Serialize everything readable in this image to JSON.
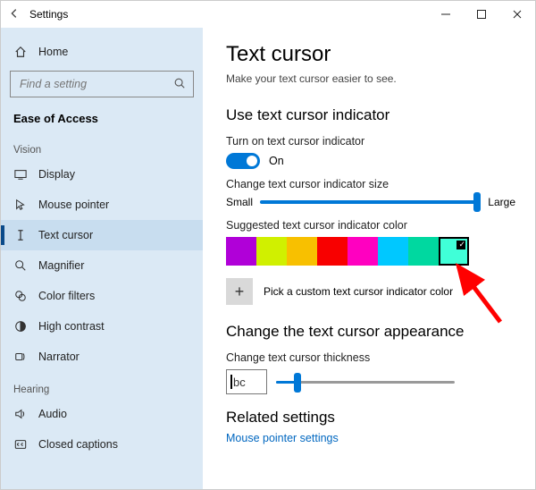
{
  "titlebar": {
    "app_title": "Settings"
  },
  "sidebar": {
    "home_label": "Home",
    "search_placeholder": "Find a setting",
    "section": "Ease of Access",
    "group_vision": "Vision",
    "group_hearing": "Hearing",
    "items_vision": [
      {
        "label": "Display"
      },
      {
        "label": "Mouse pointer"
      },
      {
        "label": "Text cursor"
      },
      {
        "label": "Magnifier"
      },
      {
        "label": "Color filters"
      },
      {
        "label": "High contrast"
      },
      {
        "label": "Narrator"
      }
    ],
    "items_hearing": [
      {
        "label": "Audio"
      },
      {
        "label": "Closed captions"
      }
    ]
  },
  "main": {
    "title": "Text cursor",
    "subtitle": "Make your text cursor easier to see.",
    "section_indicator": "Use text cursor indicator",
    "toggle_label": "Turn on text cursor indicator",
    "toggle_state": "On",
    "size_label": "Change text cursor indicator size",
    "size_small": "Small",
    "size_large": "Large",
    "color_label": "Suggested text cursor indicator color",
    "colors": [
      "#b000d8",
      "#d0f000",
      "#f8c000",
      "#f80000",
      "#ff00c0",
      "#00c8ff",
      "#00d8a0",
      "#40ffd8"
    ],
    "selected_color_index": 7,
    "custom_label": "Pick a custom text cursor indicator color",
    "section_appearance": "Change the text cursor appearance",
    "thickness_label": "Change text cursor thickness",
    "thickness_preview": "bc",
    "section_related": "Related settings",
    "link_mouse": "Mouse pointer settings"
  }
}
